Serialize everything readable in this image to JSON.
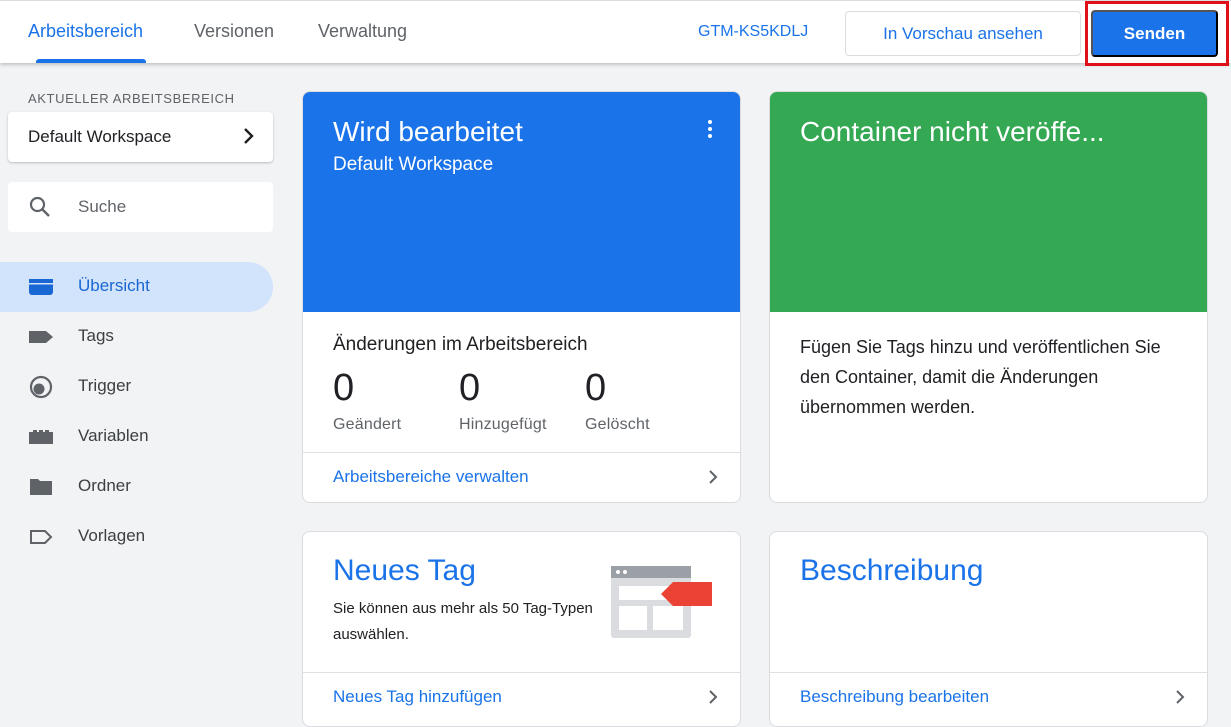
{
  "header": {
    "tabs": [
      {
        "label": "Arbeitsbereich",
        "active": true
      },
      {
        "label": "Versionen",
        "active": false
      },
      {
        "label": "Verwaltung",
        "active": false
      }
    ],
    "container_id": "GTM-KS5KDLJ",
    "preview_label": "In Vorschau ansehen",
    "submit_label": "Senden"
  },
  "sidebar": {
    "workspace_caption": "AKTUELLER ARBEITSBEREICH",
    "workspace_name": "Default Workspace",
    "search_placeholder": "Suche",
    "items": [
      {
        "label": "Übersicht",
        "icon": "overview-icon",
        "active": true
      },
      {
        "label": "Tags",
        "icon": "tag-icon",
        "active": false
      },
      {
        "label": "Trigger",
        "icon": "trigger-icon",
        "active": false
      },
      {
        "label": "Variablen",
        "icon": "variables-icon",
        "active": false
      },
      {
        "label": "Ordner",
        "icon": "folder-icon",
        "active": false
      },
      {
        "label": "Vorlagen",
        "icon": "template-icon",
        "active": false
      }
    ]
  },
  "workspace_card": {
    "title": "Wird bearbeitet",
    "subtitle": "Default Workspace",
    "changes_title": "Änderungen im Arbeitsbereich",
    "stats": [
      {
        "value": "0",
        "label": "Geändert"
      },
      {
        "value": "0",
        "label": "Hinzugefügt"
      },
      {
        "value": "0",
        "label": "Gelöscht"
      }
    ],
    "footer_link": "Arbeitsbereiche verwalten"
  },
  "container_card": {
    "title": "Container nicht veröffe...",
    "text": "Fügen Sie Tags hinzu und veröffentlichen Sie den Container, damit die Änderungen übernommen werden."
  },
  "new_tag_card": {
    "title": "Neues Tag",
    "text": "Sie können aus mehr als 50 Tag-Typen auswählen.",
    "footer_link": "Neues Tag hinzufügen"
  },
  "description_card": {
    "title": "Beschreibung",
    "footer_link": "Beschreibung bearbeiten"
  },
  "colors": {
    "accent": "#1a73e8",
    "hero_blue": "#1a73e8",
    "hero_green": "#34a853",
    "highlight": "#e0101b"
  }
}
